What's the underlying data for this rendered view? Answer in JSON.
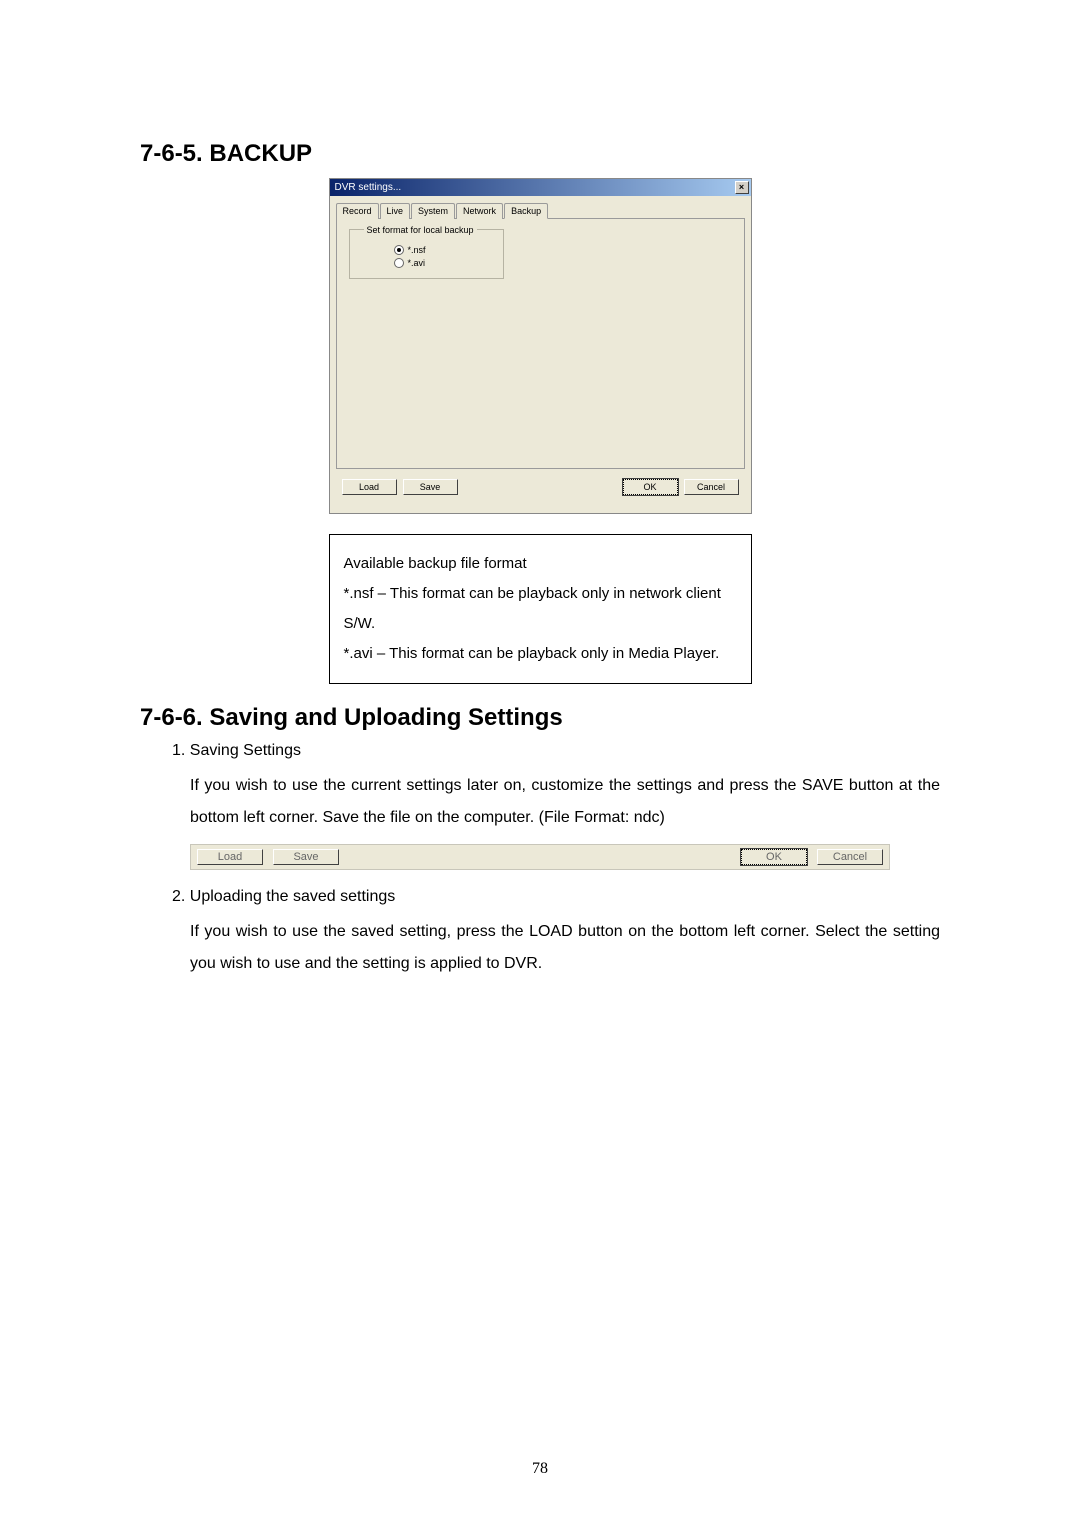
{
  "sections": {
    "backup": {
      "heading": "7-6-5. BACKUP"
    },
    "saving": {
      "heading": "7-6-6. Saving and Uploading Settings"
    }
  },
  "dvr_dialog": {
    "title": "DVR settings...",
    "close_glyph": "×",
    "tabs": [
      "Record",
      "Live",
      "System",
      "Network",
      "Backup"
    ],
    "active_tab_index": 4,
    "fieldset_label": "Set format for local backup",
    "radio_options": [
      {
        "label": "*.nsf",
        "selected": true
      },
      {
        "label": "*.avi",
        "selected": false
      }
    ],
    "buttons": {
      "load": "Load",
      "save": "Save",
      "ok": "OK",
      "cancel": "Cancel"
    }
  },
  "info_box": {
    "line1": "Available backup file format",
    "line2": "*.nsf – This format can be playback only in network client S/W.",
    "line3": "*.avi – This format can be playback only in Media Player."
  },
  "sub_items": [
    {
      "title": "1. Saving Settings",
      "text": "If you wish to use the current settings later on, customize the settings and press the SAVE button at the bottom left corner. Save the file on the computer. (File Format: ndc)"
    },
    {
      "title": "2. Uploading the saved settings",
      "text": "If you wish to use the saved setting, press the LOAD button on the bottom left corner. Select the setting you wish to use and the setting is applied to DVR."
    }
  ],
  "button_strip": {
    "load": "Load",
    "save": "Save",
    "ok": "OK",
    "cancel": "Cancel"
  },
  "page_number": "78"
}
